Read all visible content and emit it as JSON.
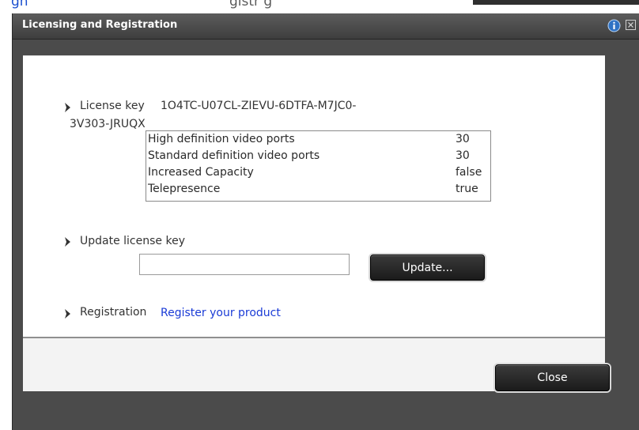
{
  "header_fragment": {
    "left_text": "gn",
    "right_text": "gistr g"
  },
  "window": {
    "title": "Licensing and Registration",
    "info_icon": "info-icon",
    "close_icon": "close-x-icon"
  },
  "license": {
    "label": "License key",
    "key_line1": "1O4TC-U07CL-ZIEVU-6DTFA-M7JC0-",
    "key_line2": "3V303-JRUQX",
    "features": [
      {
        "name": "High definition video ports",
        "value": "30"
      },
      {
        "name": "Standard definition video ports",
        "value": "30"
      },
      {
        "name": "Increased Capacity",
        "value": "false"
      },
      {
        "name": "Telepresence",
        "value": "true"
      }
    ]
  },
  "update": {
    "label": "Update license key",
    "input_value": "",
    "button_label": "Update..."
  },
  "registration": {
    "label": "Registration",
    "link_text": "Register your product"
  },
  "footer": {
    "close_label": "Close"
  },
  "icons": {
    "bullet": "chevron-right-icon"
  },
  "colors": {
    "title_bar": "#4a4a4a",
    "link": "#1a3bd6",
    "button": "#1f1f1f"
  }
}
